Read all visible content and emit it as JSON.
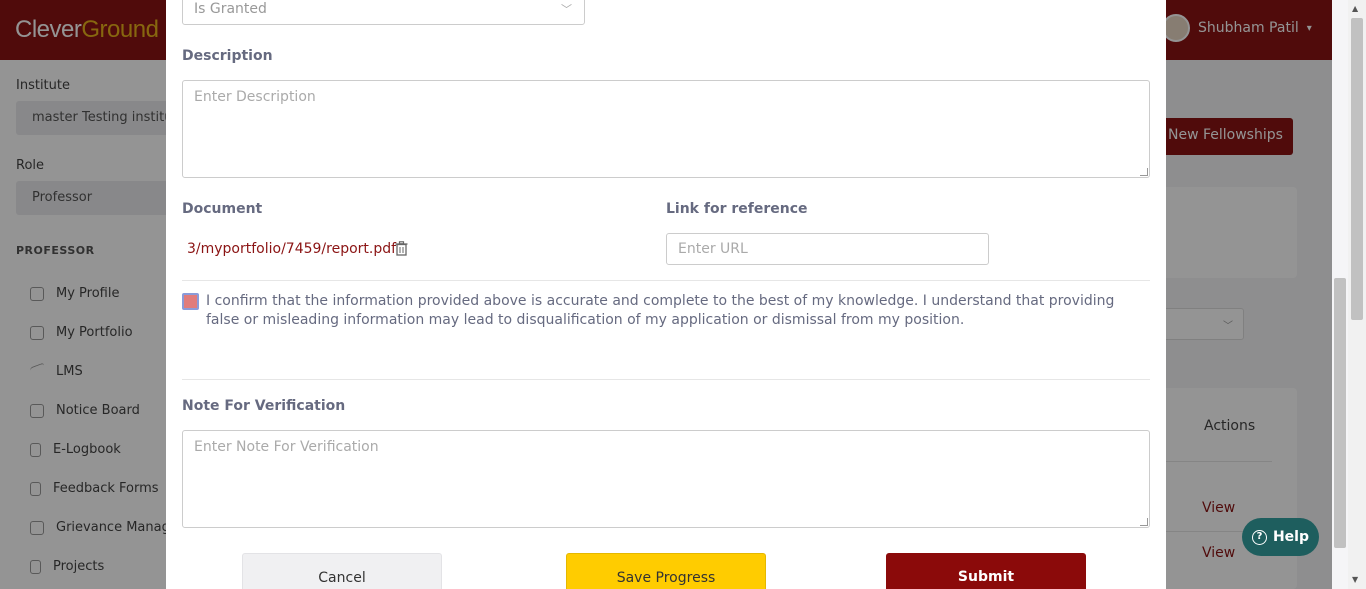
{
  "app": {
    "logo_part1": "Clever",
    "logo_part2": "Ground",
    "user_name": "Shubham Patil"
  },
  "sidebar": {
    "institute_label": "Institute",
    "institute_value": "master Testing institu...",
    "role_label": "Role",
    "role_value": "Professor",
    "section_title": "PROFESSOR",
    "items": [
      {
        "label": "My Profile",
        "icon": "user-icon"
      },
      {
        "label": "My Portfolio",
        "icon": "trophy-icon"
      },
      {
        "label": "LMS",
        "icon": "chart-line-icon"
      },
      {
        "label": "Notice Board",
        "icon": "calendar-icon"
      },
      {
        "label": "E-Logbook",
        "icon": "book-icon"
      },
      {
        "label": "Feedback Forms",
        "icon": "book-icon"
      },
      {
        "label": "Grievance Manage",
        "icon": "user-icon"
      },
      {
        "label": "Projects",
        "icon": "book-icon"
      }
    ]
  },
  "background": {
    "new_button": "New Fellowships",
    "actions_header": "Actions",
    "view_links": [
      "View",
      "View"
    ]
  },
  "modal": {
    "status_select_value": "Is Granted",
    "description_label": "Description",
    "description_placeholder": "Enter Description",
    "document_label": "Document",
    "document_link": "3/myportfolio/7459/report.pdf",
    "link_label": "Link for reference",
    "link_placeholder": "Enter URL",
    "confirm_text": "I confirm that the information provided above is accurate and complete to the best of my knowledge. I understand that providing false or misleading information may lead to disqualification of my application or dismissal from my position.",
    "note_label": "Note For Verification",
    "note_placeholder": "Enter Note For Verification",
    "cancel_label": "Cancel",
    "save_label": "Save Progress",
    "submit_label": "Submit"
  },
  "help": {
    "label": "Help"
  },
  "colors": {
    "brand": "#8b1414",
    "save": "#ffcc00",
    "help": "#1e5e5e"
  }
}
